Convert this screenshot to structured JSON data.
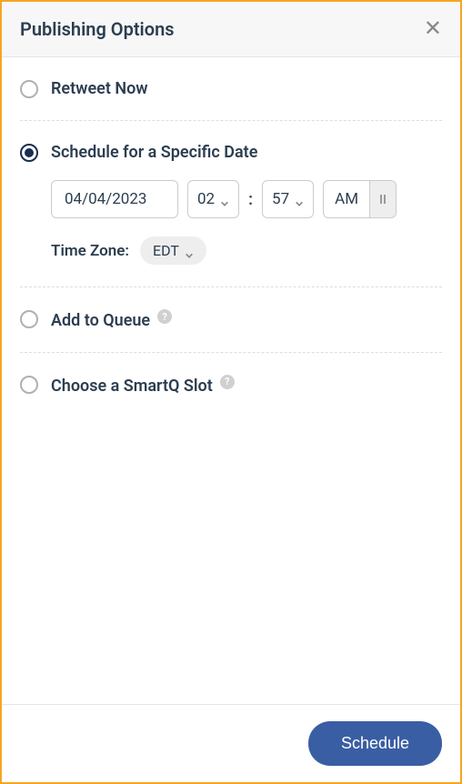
{
  "header": {
    "title": "Publishing Options"
  },
  "options": {
    "retweet_now": {
      "label": "Retweet Now",
      "selected": false
    },
    "schedule_specific": {
      "label": "Schedule for a Specific Date",
      "selected": true,
      "date": "04/04/2023",
      "hour": "02",
      "minute": "57",
      "ampm": "AM",
      "timezone_label": "Time Zone:",
      "timezone": "EDT"
    },
    "add_to_queue": {
      "label": "Add to Queue",
      "selected": false
    },
    "smartq": {
      "label": "Choose a SmartQ Slot",
      "selected": false
    }
  },
  "footer": {
    "schedule_label": "Schedule"
  }
}
